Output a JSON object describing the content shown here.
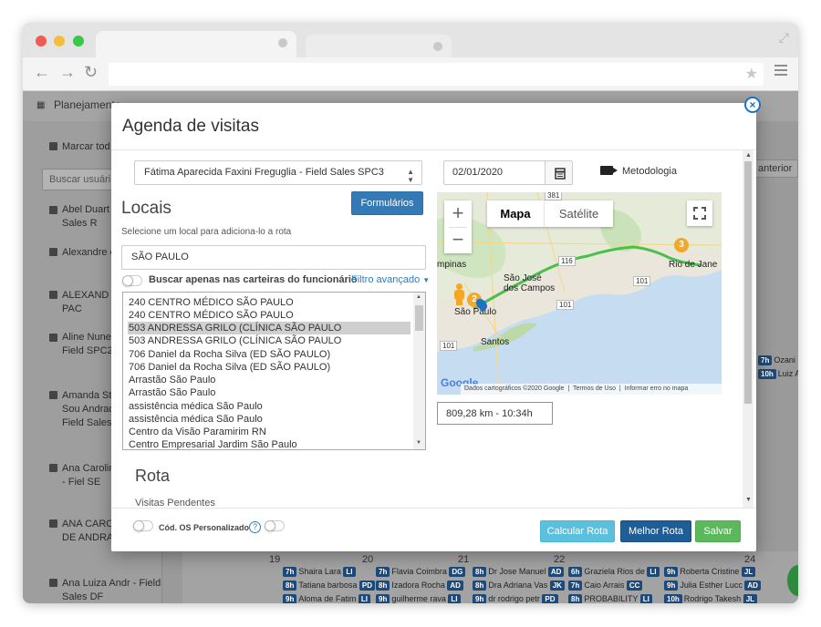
{
  "app": {
    "title": "Planejamento",
    "sidebar": {
      "mark_all": "Marcar tod",
      "search_placeholder": "Buscar usuári",
      "users": [
        "Abel Duart - Field Sales R",
        "Alexandre de Souza",
        "ALEXAND TEIXEIRA PAC",
        "Aline Nune Santos - Field SPC2",
        "Amanda Stephanne Sou Andrade Barr Field Sales CO",
        "Ana Carolin dos Reis - Fiel SE",
        "ANA CARO PEREIRA DE ANDRADE",
        "Ana Luiza Andr - Field Sales DF"
      ]
    },
    "calendar": {
      "prev_label": "anterior",
      "side_events": [
        {
          "time": "7h",
          "name": "Ozani"
        },
        {
          "time": "10h",
          "name": "Luiz A"
        }
      ],
      "days": [
        {
          "num": "19",
          "events": [
            {
              "time": "7h",
              "name": "Shaira Lara",
              "tag": "LI"
            },
            {
              "time": "8h",
              "name": "Tatiana barbosa",
              "tag": "PD"
            },
            {
              "time": "9h",
              "name": "Aloma de Fatim",
              "tag": "LI"
            }
          ]
        },
        {
          "num": "20",
          "events": [
            {
              "time": "7h",
              "name": "Flavia Coimbra",
              "tag": "DG"
            },
            {
              "time": "8h",
              "name": "Izadora Rocha",
              "tag": "AD"
            },
            {
              "time": "9h",
              "name": "guilherme rava",
              "tag": "LI"
            }
          ]
        },
        {
          "num": "21",
          "events": [
            {
              "time": "8h",
              "name": "Dr Jose Manuel",
              "tag": "AD"
            },
            {
              "time": "8h",
              "name": "Dra Adriana Vas",
              "tag": "JK"
            },
            {
              "time": "9h",
              "name": "dr rodrigo petr",
              "tag": "PD"
            }
          ]
        },
        {
          "num": "22",
          "events": [
            {
              "time": "6h",
              "name": "Graziela Rios de",
              "tag": "LI"
            },
            {
              "time": "7h",
              "name": "Caio Arrais",
              "tag": "CC"
            },
            {
              "time": "8h",
              "name": "PROBABILITY",
              "tag": "LI"
            }
          ]
        },
        {
          "num": "24",
          "events": [
            {
              "time": "9h",
              "name": "Roberta Cristine",
              "tag": "JL"
            },
            {
              "time": "9h",
              "name": "Julia Esther Lucc",
              "tag": "AD"
            },
            {
              "time": "10h",
              "name": "Rodrigo Takesh",
              "tag": "JL"
            }
          ]
        }
      ]
    }
  },
  "modal": {
    "title": "Agenda de visitas",
    "close_label": "×",
    "employee": "Fátima Aparecida Faxini Freguglia - Field Sales SPC3",
    "locais_title": "Locais",
    "formularios_label": "Formulários",
    "hint": "Selecione um local para adiciona-lo a rota",
    "search_value": "SÃO PAULO",
    "only_wallets_label": "Buscar apenas nas carteiras do funcionário",
    "advanced_filter_label": "Filtro avançado",
    "locations": [
      "240 CENTRO MÉDICO SÃO PAULO",
      "240 CENTRO MÉDICO SÃO PAULO",
      "503 ANDRESSA GRILO (CLÍNICA SÃO PAULO",
      "503 ANDRESSA GRILO (CLÍNICA SÃO PAULO",
      "706 Daniel da Rocha Silva (ED SÃO PAULO)",
      "706 Daniel da Rocha Silva (ED SÃO PAULO)",
      "Arrastão São Paulo",
      "Arrastão São Paulo",
      "assistência médica São Paulo",
      "assistência médica São Paulo",
      "Centro da Visão Paramirim RN",
      "Centro Empresarial Jardim São Paulo"
    ],
    "selected_index": 2,
    "rota_title": "Rota",
    "visitas_pendentes": "Visitas Pendentes",
    "date": "02/01/2020",
    "metodologia": "Metodologia",
    "map": {
      "tab_map": "Mapa",
      "tab_satellite": "Satélite",
      "zoom_in": "+",
      "zoom_out": "−",
      "labels": {
        "campinas": "mpinas",
        "sjc": "São José dos Campos",
        "sao_paulo": "São Paulo",
        "santos": "Santos",
        "rio": "Rio de Jane",
        "r381": "381",
        "r116": "116",
        "r101a": "101",
        "r101b": "101",
        "r101c": "101"
      },
      "marker_a": "2",
      "marker_b": "3",
      "google": "Google",
      "footer_data": "Dados cartográficos ©2020 Google",
      "footer_terms": "Termos de Uso",
      "footer_report": "Informar erro no mapa"
    },
    "distance": "809,28 km - 10:34h",
    "cod_os_label": "Cód. OS Personalizado",
    "help": "?",
    "btn_calc": "Calcular Rota",
    "btn_best": "Melhor Rota",
    "btn_save": "Salvar"
  }
}
